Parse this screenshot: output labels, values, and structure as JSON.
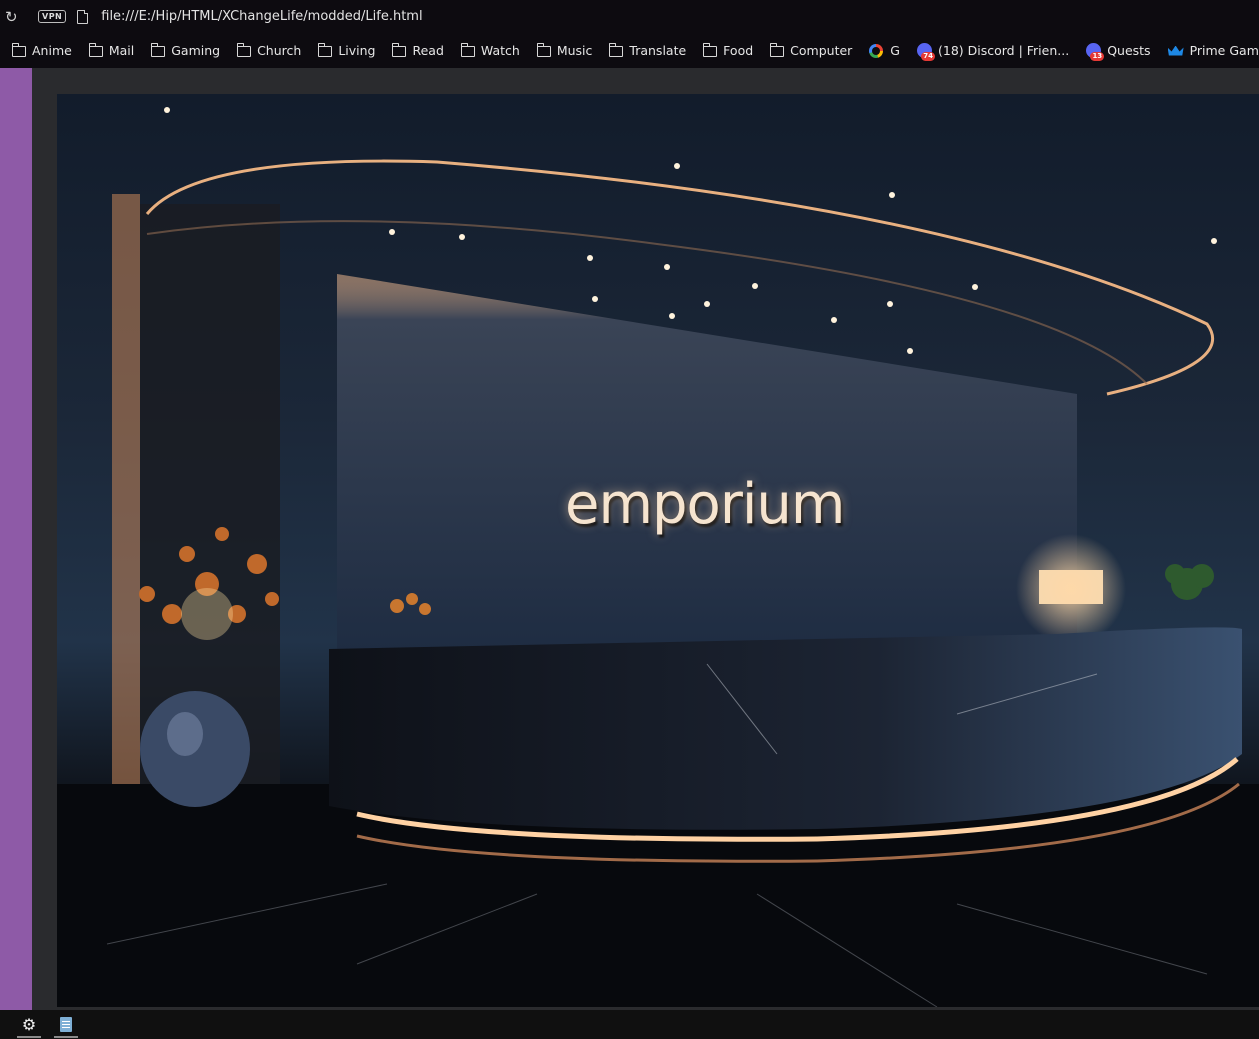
{
  "browser": {
    "reload_icon": "reload-icon",
    "vpn_label": "VPN",
    "url": "file:///E:/Hip/HTML/XChangeLife/modded/Life.html"
  },
  "bookmarks": [
    {
      "label": "Anime",
      "icon": "folder-icon"
    },
    {
      "label": "Mail",
      "icon": "folder-icon"
    },
    {
      "label": "Gaming",
      "icon": "folder-icon"
    },
    {
      "label": "Church",
      "icon": "folder-icon"
    },
    {
      "label": "Living",
      "icon": "folder-icon"
    },
    {
      "label": "Read",
      "icon": "folder-icon"
    },
    {
      "label": "Watch",
      "icon": "folder-icon"
    },
    {
      "label": "Music",
      "icon": "folder-icon"
    },
    {
      "label": "Translate",
      "icon": "folder-icon"
    },
    {
      "label": "Food",
      "icon": "folder-icon"
    },
    {
      "label": "Computer",
      "icon": "folder-icon"
    },
    {
      "label": "G",
      "icon": "google-icon"
    },
    {
      "label": "(18) Discord | Frien...",
      "icon": "discord-icon",
      "badge": "74"
    },
    {
      "label": "Quests",
      "icon": "discord-icon",
      "badge": "13"
    },
    {
      "label": "Prime Gaming - H...",
      "icon": "crown-icon"
    }
  ],
  "scene": {
    "logo_text": "emporium"
  },
  "taskbar": [
    {
      "icon": "settings-gear-icon"
    },
    {
      "icon": "notepad-icon"
    }
  ],
  "colors": {
    "sidebar_accent": "#8e5aa7",
    "chrome_bg": "#0d0b10",
    "glow": "#ffb077"
  }
}
